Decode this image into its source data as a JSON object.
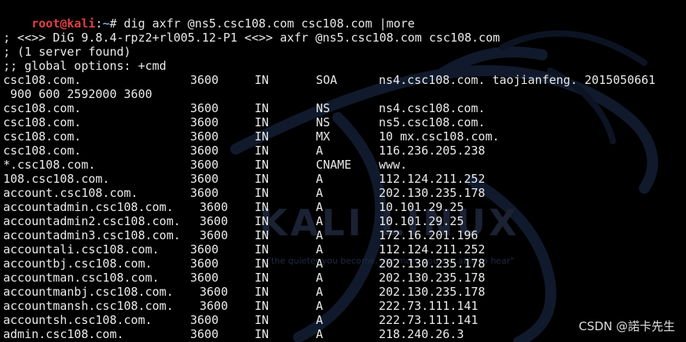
{
  "prompt": {
    "user_host": "root@kali",
    "sep": ":",
    "path": "~",
    "symbol": "#",
    "command": " dig axfr @ns5.csc108.com csc108.com |more"
  },
  "header_lines": [
    "; <<>> DiG 9.8.4-rpz2+rl005.12-P1 <<>> axfr @ns5.csc108.com csc108.com",
    "; (1 server found)",
    ";; global options: +cmd"
  ],
  "soa_continuation": " 900 600 2592000 3600",
  "records": [
    {
      "name": "csc108.com.",
      "ttl": "3600",
      "class": "IN",
      "type": "SOA",
      "data": "ns4.csc108.com. taojianfeng. 2015050661"
    },
    {
      "name": "csc108.com.",
      "ttl": "3600",
      "class": "IN",
      "type": "NS",
      "data": "ns4.csc108.com."
    },
    {
      "name": "csc108.com.",
      "ttl": "3600",
      "class": "IN",
      "type": "NS",
      "data": "ns5.csc108.com."
    },
    {
      "name": "csc108.com.",
      "ttl": "3600",
      "class": "IN",
      "type": "MX",
      "data": "10 mx.csc108.com."
    },
    {
      "name": "csc108.com.",
      "ttl": "3600",
      "class": "IN",
      "type": "A",
      "data": "116.236.205.238"
    },
    {
      "name": "*.csc108.com.",
      "ttl": "3600",
      "class": "IN",
      "type": "CNAME",
      "data": "www."
    },
    {
      "name": "108.csc108.com.",
      "ttl": "3600",
      "class": "IN",
      "type": "A",
      "data": "112.124.211.252"
    },
    {
      "name": "account.csc108.com.",
      "ttl": "3600",
      "class": "IN",
      "type": "A",
      "data": "202.130.235.178"
    },
    {
      "name": "accountadmin.csc108.com.",
      "ttl": "3600",
      "class": "IN",
      "type": "A",
      "data": "10.101.29.25"
    },
    {
      "name": "accountadmin2.csc108.com.",
      "ttl": "3600",
      "class": "IN",
      "type": "A",
      "data": "10.101.29.25"
    },
    {
      "name": "accountadmin3.csc108.com.",
      "ttl": "3600",
      "class": "IN",
      "type": "A",
      "data": "172.16.201.196"
    },
    {
      "name": "accountali.csc108.com.",
      "ttl": "3600",
      "class": "IN",
      "type": "A",
      "data": "112.124.211.252"
    },
    {
      "name": "accountbj.csc108.com.",
      "ttl": "3600",
      "class": "IN",
      "type": "A",
      "data": "202.130.235.178"
    },
    {
      "name": "accountman.csc108.com.",
      "ttl": "3600",
      "class": "IN",
      "type": "A",
      "data": "202.130.235.178"
    },
    {
      "name": "accountmanbj.csc108.com.",
      "ttl": "3600",
      "class": "IN",
      "type": "A",
      "data": "202.130.235.178"
    },
    {
      "name": "accountmansh.csc108.com.",
      "ttl": "3600",
      "class": "IN",
      "type": "A",
      "data": "222.73.111.141"
    },
    {
      "name": "accountsh.csc108.com.",
      "ttl": "3600",
      "class": "IN",
      "type": "A",
      "data": "222.73.111.141"
    },
    {
      "name": "admin.csc108.com.",
      "ttl": "3600",
      "class": "IN",
      "type": "A",
      "data": "218.240.26.3"
    }
  ],
  "background": {
    "logo_text": "KALI LINUX",
    "tagline": "\"the quieter you become, the more you are able to hear\""
  },
  "watermark": "CSDN @諾卡先生",
  "colors": {
    "background": "#000000",
    "text": "#eaeaea",
    "prompt_user": "#e04040",
    "prompt_path": "#6fa8dc"
  }
}
